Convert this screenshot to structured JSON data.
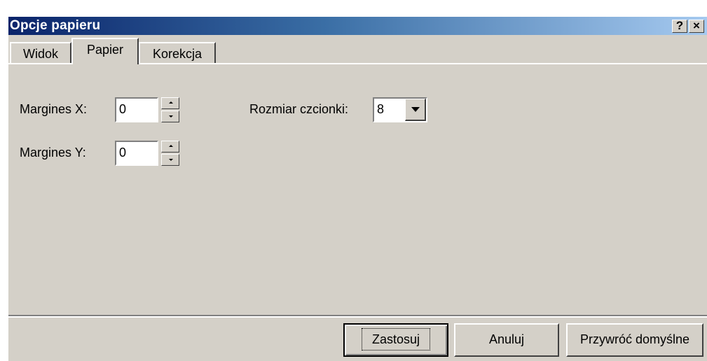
{
  "window": {
    "title": "Opcje papieru",
    "help_glyph": "?",
    "close_glyph": "×"
  },
  "tabs": [
    {
      "label": "Widok",
      "active": false
    },
    {
      "label": "Papier",
      "active": true
    },
    {
      "label": "Korekcja",
      "active": false
    }
  ],
  "form": {
    "margin_x_label": "Margines X:",
    "margin_x_value": "0",
    "margin_y_label": "Margines Y:",
    "margin_y_value": "0",
    "font_size_label": "Rozmiar czcionki:",
    "font_size_value": "8"
  },
  "buttons": {
    "apply_label": "Zastosuj",
    "cancel_label": "Anuluj",
    "restore_label": "Przywróć domyślne"
  },
  "colors": {
    "titlebar_start": "#0a246a",
    "titlebar_end": "#a6caf0",
    "face": "#d4d0c8"
  }
}
